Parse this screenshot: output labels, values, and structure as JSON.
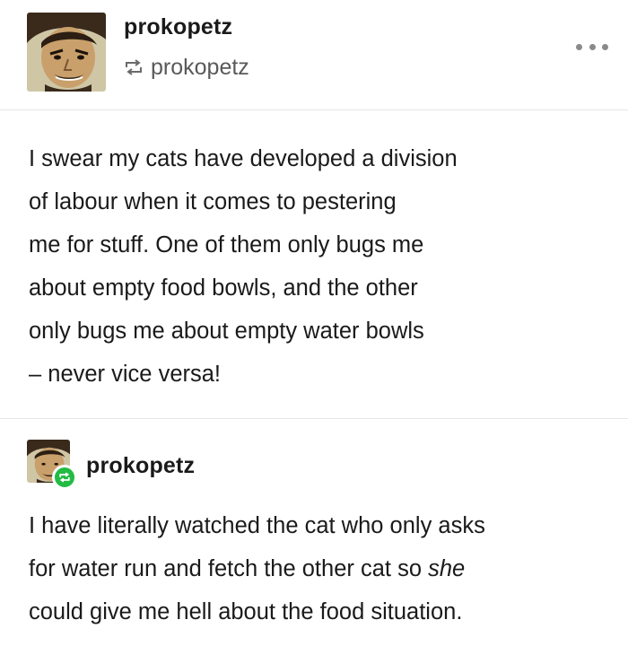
{
  "post": {
    "author": "prokopetz",
    "reblogged_from": "prokopetz",
    "original_text_lines": [
      "I swear my cats have developed a division",
      "of labour when it comes to pestering",
      "me for stuff. One of them only bugs me",
      "about empty food bowls, and the other",
      "only bugs me about empty water bowls",
      "– never vice versa!"
    ]
  },
  "reply": {
    "author": "prokopetz",
    "line1": "I have literally watched the cat who only asks",
    "line2": "for water run and fetch the other cat so ",
    "line2_emphasis": "she",
    "line3": "could give me hell about the food situation."
  },
  "icons": {
    "reblog": "reblog-icon",
    "more": "more-options-icon",
    "avatar": "avatar"
  },
  "colors": {
    "reblog_badge": "#22bb44",
    "muted_text": "#595959",
    "divider": "#e6e6e6"
  }
}
